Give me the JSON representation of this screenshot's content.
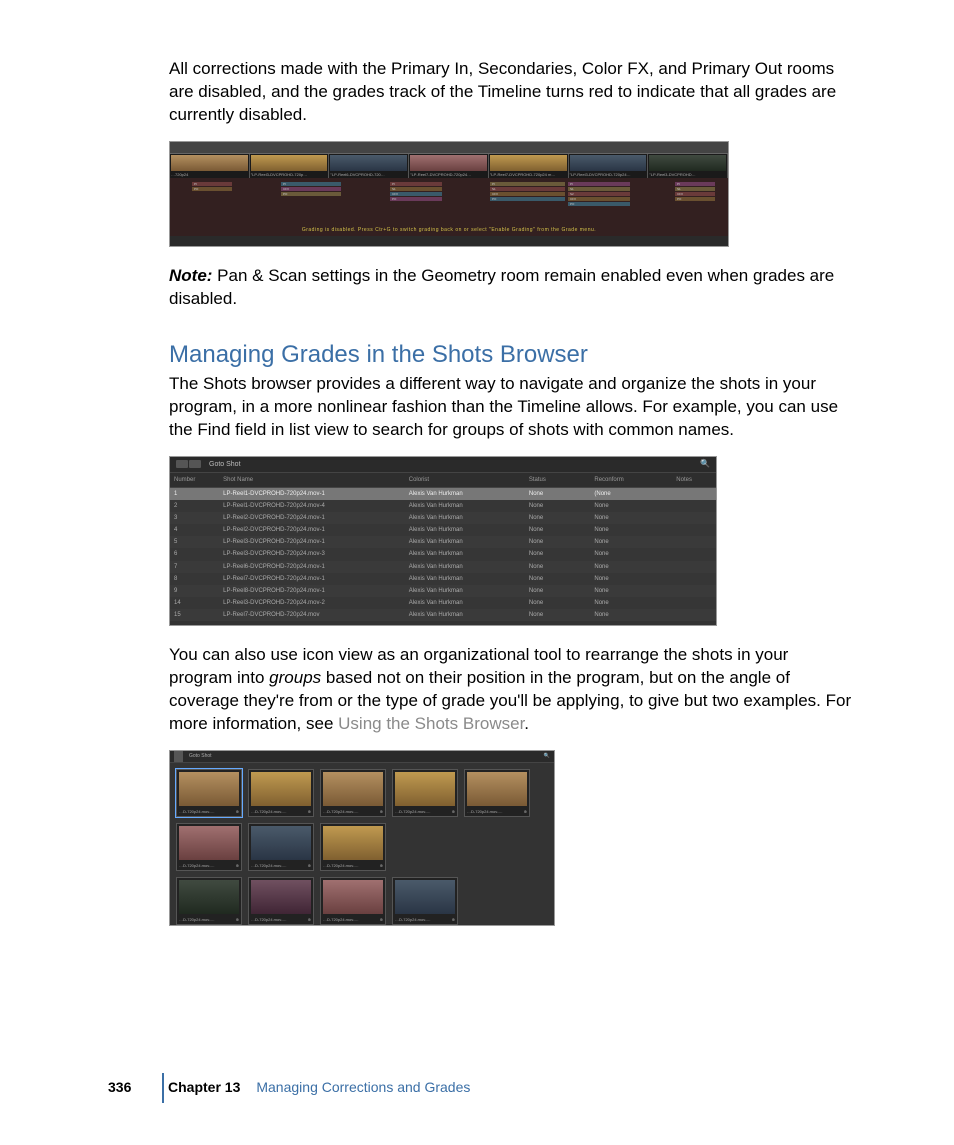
{
  "paragraphs": {
    "p1": "All corrections made with the Primary In, Secondaries, Color FX, and Primary Out rooms are disabled, and the grades track of the Timeline turns red to indicate that all grades are currently disabled.",
    "note_label": "Note:",
    "note_body": "  Pan & Scan settings in the Geometry room remain enabled even when grades are disabled.",
    "heading": "Managing Grades in the Shots Browser",
    "p2": "The Shots browser provides a different way to navigate and organize the shots in your program, in a more nonlinear fashion than the Timeline allows. For example, you can use the Find field in list view to search for groups of shots with common names.",
    "p3a": "You can also use icon view as an organizational tool to rearrange the shots in your program into ",
    "p3_groups": "groups",
    "p3b": " based not on their position in the program, but on the angle of coverage they're from or the type of grade you'll be applying, to give but two examples. For more information, see ",
    "p3_link": "Using the Shots Browser",
    "p3c": "."
  },
  "timeline": {
    "clips": [
      {
        "label": "…720p24",
        "thumb": "thumb-a"
      },
      {
        "label": "\"LP-Reel3-DVCPROHD-720p…",
        "thumb": "thumb-d"
      },
      {
        "label": "\"LP-Reel6-DVCPROHD-720…",
        "thumb": "thumb-b"
      },
      {
        "label": "\"LP-Reel7-DVCPROHD-720p24…",
        "thumb": "thumb-c"
      },
      {
        "label": "\"LP-Reel7-DVCPROHD-720p24 m…",
        "thumb": "thumb-d"
      },
      {
        "label": "\"LP-Reel3-DVCPROHD-720p24…",
        "thumb": "thumb-b"
      },
      {
        "label": "\"LP-Reel3-DVCPROHD…",
        "thumb": "thumb-e"
      }
    ],
    "track_labels": [
      "PI",
      "PO",
      "PI",
      "CFX",
      "PO",
      "PI",
      "S1",
      "CFX",
      "PO",
      "PI",
      "S1",
      "CFX",
      "PO",
      "PI",
      "S1",
      "S2",
      "CFX",
      "PO",
      "PI",
      "S1",
      "CFX",
      "PO"
    ],
    "message": "Grading is disabled. Press Ctr+G to switch grading back on or select \"Enable Grading\" from the Grade menu."
  },
  "shotslist": {
    "goto_label": "Goto Shot",
    "headers": [
      "Number",
      "Shot Name",
      "Colorist",
      "Status",
      "Reconform",
      "Notes"
    ],
    "rows": [
      {
        "n": "1",
        "name": "LP-Reel1-DVCPROHD-720p24.mov-1",
        "col": "Alexis Van Hurkman",
        "status": "None",
        "rec": "(None"
      },
      {
        "n": "2",
        "name": "LP-Reel1-DVCPROHD-720p24.mov-4",
        "col": "Alexis Van Hurkman",
        "status": "None",
        "rec": "None"
      },
      {
        "n": "3",
        "name": "LP-Reel2-DVCPROHD-720p24.mov-1",
        "col": "Alexis Van Hurkman",
        "status": "None",
        "rec": "None"
      },
      {
        "n": "4",
        "name": "LP-Reel2-DVCPROHD-720p24.mov-1",
        "col": "Alexis Van Hurkman",
        "status": "None",
        "rec": "None"
      },
      {
        "n": "5",
        "name": "LP-Reel3-DVCPROHD-720p24.mov-1",
        "col": "Alexis Van Hurkman",
        "status": "None",
        "rec": "None"
      },
      {
        "n": "6",
        "name": "LP-Reel3-DVCPROHD-720p24.mov-3",
        "col": "Alexis Van Hurkman",
        "status": "None",
        "rec": "None"
      },
      {
        "n": "7",
        "name": "LP-Reel6-DVCPROHD-720p24.mov-1",
        "col": "Alexis Van Hurkman",
        "status": "None",
        "rec": "None"
      },
      {
        "n": "8",
        "name": "LP-Reel7-DVCPROHD-720p24.mov-1",
        "col": "Alexis Van Hurkman",
        "status": "None",
        "rec": "None"
      },
      {
        "n": "9",
        "name": "LP-Reel8-DVCPROHD-720p24.mov-1",
        "col": "Alexis Van Hurkman",
        "status": "None",
        "rec": "None"
      },
      {
        "n": "14",
        "name": "LP-Reel3-DVCPROHD-720p24.mov-2",
        "col": "Alexis Van Hurkman",
        "status": "None",
        "rec": "None"
      },
      {
        "n": "15",
        "name": "LP-Reel7-DVCPROHD-720p24.mov",
        "col": "Alexis Van Hurkman",
        "status": "None",
        "rec": "None"
      }
    ]
  },
  "icongrid": {
    "goto_label": "Goto Shot",
    "cells": [
      {
        "lab": "…D-720p24.mov-…",
        "sel": true,
        "thumb": "thumb-a"
      },
      {
        "lab": "…D-720p24.mov-…",
        "thumb": "thumb-d"
      },
      {
        "lab": "…D-720p24.mov-…",
        "thumb": "thumb-a"
      },
      {
        "lab": "…D-720p24.mov-…",
        "thumb": "thumb-d"
      },
      {
        "lab": "…D-720p24.mov-…",
        "thumb": "thumb-a"
      },
      {
        "lab": "…D-720p24.mov-…",
        "thumb": "thumb-c"
      },
      {
        "lab": "…D-720p24.mov-…",
        "thumb": "thumb-b"
      },
      {
        "lab": "…D-720p24.mov-…",
        "thumb": "thumb-d"
      },
      null,
      null,
      {
        "lab": "…D-720p24.mov-…",
        "thumb": "thumb-e"
      },
      {
        "lab": "…D-720p24.mov-…",
        "thumb": "thumb-f"
      },
      {
        "lab": "…D-720p24.mov-…",
        "thumb": "thumb-c"
      },
      {
        "lab": "…D-720p24.mov-…",
        "thumb": "thumb-b"
      }
    ]
  },
  "footer": {
    "page": "336",
    "chapter": "Chapter 13",
    "title": "Managing Corrections and Grades"
  }
}
